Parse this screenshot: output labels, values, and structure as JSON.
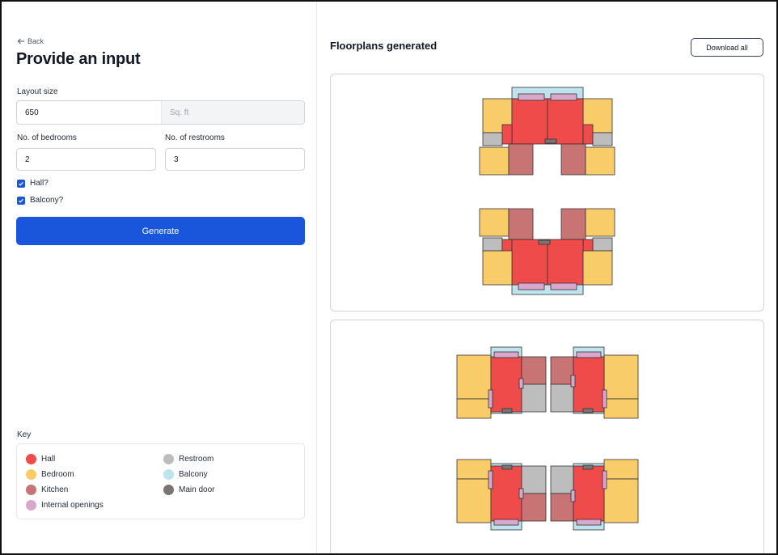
{
  "left": {
    "back_label": "Back",
    "title": "Provide an input",
    "layout_size_label": "Layout size",
    "layout_size_value": "650",
    "layout_size_unit": "Sq. ft",
    "bedrooms_label": "No. of bedrooms",
    "bedrooms_value": "2",
    "restrooms_label": "No. of restrooms",
    "restrooms_value": "3",
    "hall_label": "Hall?",
    "hall_checked": true,
    "balcony_label": "Balcony?",
    "balcony_checked": true,
    "generate_label": "Generate"
  },
  "key": {
    "title": "Key",
    "items": [
      {
        "label": "Hall",
        "color": "#EF4B4B"
      },
      {
        "label": "Restroom",
        "color": "#BDBDBD"
      },
      {
        "label": "Bedroom",
        "color": "#F9CC6A"
      },
      {
        "label": "Balcony",
        "color": "#BFE3EC"
      },
      {
        "label": "Kitchen",
        "color": "#C97474"
      },
      {
        "label": "Main door",
        "color": "#7A7574"
      },
      {
        "label": "Internal openings",
        "color": "#D8A7CB"
      }
    ]
  },
  "right": {
    "title": "Floorplans generated",
    "download_label": "Download all"
  },
  "colors": {
    "hall": "#EF4B4B",
    "bedroom": "#F9CC6A",
    "kitchen": "#C97474",
    "restroom": "#BDBDBD",
    "balcony": "#BFE3EC",
    "main_door": "#7A7574",
    "opening": "#D8A7CB",
    "accent": "#1A56DB"
  }
}
